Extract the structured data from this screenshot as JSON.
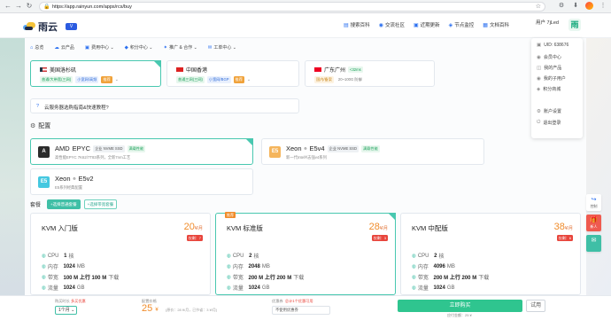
{
  "browser": {
    "url": "https://app.rainyun.com/apps/rcs/buy",
    "back": "←",
    "forward": "→",
    "reload": "↻"
  },
  "header": {
    "logo_text": "雨云",
    "links": [
      {
        "icon": "book-icon",
        "label": "搜索百科"
      },
      {
        "icon": "chat-icon",
        "label": "交流社区"
      },
      {
        "icon": "update-icon",
        "label": "近期更新"
      },
      {
        "icon": "monitor-icon",
        "label": "节点监控"
      },
      {
        "icon": "doc-icon",
        "label": "文档百科"
      }
    ],
    "username": "用户 7jLed",
    "avatar_text": "雨"
  },
  "menu": [
    {
      "icon": "home-icon",
      "label": "总览"
    },
    {
      "icon": "cloud-icon",
      "label": "云产品"
    },
    {
      "icon": "cost-icon",
      "label": "费用中心 ⌄"
    },
    {
      "icon": "points-icon",
      "label": "积分中心 ⌄"
    },
    {
      "icon": "partner-icon",
      "label": "推广 & 合作 ⌄"
    },
    {
      "icon": "support-icon",
      "label": "工单中心 ⌄"
    }
  ],
  "locations": [
    {
      "name": "美国洛杉矶",
      "flag": "us",
      "tags": [
        {
          "text": "普通/大带宽(三网)",
          "style": "green"
        },
        {
          "text": "小宽网/高频",
          "style": "blue"
        },
        {
          "text": "推荐",
          "style": "orange"
        }
      ]
    },
    {
      "name": "中国香港",
      "flag": "hk",
      "tags": [
        {
          "text": "普通三网(三网)",
          "style": "green"
        },
        {
          "text": "小宽网/BGP",
          "style": "blue"
        },
        {
          "text": "推荐",
          "style": "orange"
        }
      ]
    },
    {
      "name": "广东广州",
      "flag": "cn",
      "extra": "<32ms",
      "tags": [
        {
          "text": "国内/备案",
          "style": "yellow"
        },
        {
          "text": "20~100G 防御",
          "style": "gray"
        }
      ]
    }
  ],
  "tip": "云服务器选购指南&快速教程?",
  "sections": {
    "config": "配置",
    "package": "套餐"
  },
  "cpus": [
    {
      "badge": "A",
      "name": "AMD",
      "sup": "",
      "model": "EPYC",
      "tags": [
        "企业 NVME SSD",
        "满载性能"
      ],
      "desc": "高性能EPYC 7K62/7T83系列，全新7nm工艺",
      "color": "#2b2b2b",
      "selected": true
    },
    {
      "badge": "E5",
      "name": "Xeon",
      "sup": "®",
      "model": "E5v4",
      "tags": [
        "企业 NVME SSD",
        "满载性能"
      ],
      "desc": "新一代Intel®志强v4系列",
      "color": "#f5b55c",
      "selected": false
    },
    {
      "badge": "E5",
      "name": "Xeon",
      "sup": "®",
      "model": "E5v2",
      "tags": [],
      "desc": "E5系列经典配置",
      "color": "#45c8e0",
      "selected": false
    }
  ],
  "package_buttons": [
    {
      "label": "+选择普通套餐",
      "active": true
    },
    {
      "label": "+选择带宽套餐",
      "active": false
    }
  ],
  "plans": [
    {
      "name": "KVM 入门版",
      "price": "20",
      "unit": "¥/月",
      "left": "仅剩：7",
      "hot": "",
      "specs": [
        {
          "icon": "cpu-icon",
          "label": "CPU",
          "value": "1",
          "unit": "核"
        },
        {
          "icon": "memory-icon",
          "label": "内存",
          "value": "1024",
          "unit": "MB"
        },
        {
          "icon": "bandwidth-icon",
          "label": "带宽",
          "value": "100 M 上行 100 M",
          "unit": "下载"
        },
        {
          "icon": "traffic-icon",
          "label": "流量",
          "value": "1024",
          "unit": "GB"
        }
      ]
    },
    {
      "name": "KVM 标准版",
      "price": "28",
      "unit": "¥/月",
      "left": "仅剩：3",
      "hot": "推荐",
      "specs": [
        {
          "icon": "cpu-icon",
          "label": "CPU",
          "value": "2",
          "unit": "核"
        },
        {
          "icon": "memory-icon",
          "label": "内存",
          "value": "2048",
          "unit": "MB"
        },
        {
          "icon": "bandwidth-icon",
          "label": "带宽",
          "value": "200 M 上行 200 M",
          "unit": "下载"
        },
        {
          "icon": "traffic-icon",
          "label": "流量",
          "value": "1024",
          "unit": "GB"
        }
      ]
    },
    {
      "name": "KVM 中配版",
      "price": "38",
      "unit": "¥/月",
      "left": "仅剩：6",
      "hot": "",
      "specs": [
        {
          "icon": "cpu-icon",
          "label": "CPU",
          "value": "2",
          "unit": "核"
        },
        {
          "icon": "memory-icon",
          "label": "内存",
          "value": "4096",
          "unit": "MB"
        },
        {
          "icon": "bandwidth-icon",
          "label": "带宽",
          "value": "200 M 上行 200 M",
          "unit": "下载"
        },
        {
          "icon": "traffic-icon",
          "label": "流量",
          "value": "1024",
          "unit": "GB"
        }
      ]
    }
  ],
  "dropdown": {
    "uid": "UID: 638676",
    "items": [
      "会员中心",
      "我的产品",
      "我的子用户",
      "积分商城",
      "账户设置",
      "退出登录"
    ]
  },
  "side_tools": [
    {
      "label": "控制",
      "icon": "share-icon"
    },
    {
      "label": "新人",
      "icon": "gift-icon"
    },
    {
      "label": "",
      "icon": "chat-icon"
    }
  ],
  "bottom": {
    "duration_label": "购买时长",
    "duration_hint": "多买优惠",
    "duration_value": "1个月",
    "price_label": "配置价格",
    "price": "25",
    "price_unit": "¥",
    "price_note": "(原价：28 ¥/月，已节省：3 ¥/月)",
    "coupon_label": "优惠券",
    "coupon_hint": "总计1个优惠可用",
    "coupon_value": "不使用优惠券",
    "buy_label": "立即购买",
    "buy_sub": "应付金额：25 ¥",
    "try_label": "试用"
  },
  "colors": {
    "accent": "#3fbfa6",
    "price": "#f08c2b",
    "buy": "#2fc58f"
  }
}
